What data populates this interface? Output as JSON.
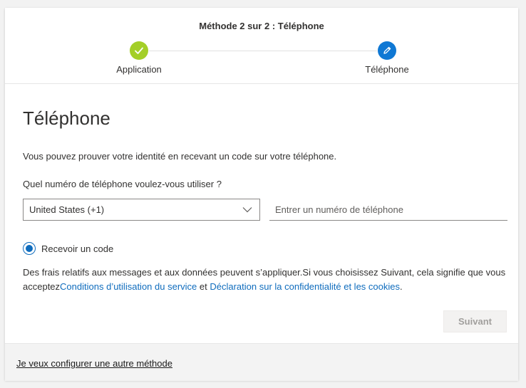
{
  "wizard": {
    "title": "Méthode 2 sur 2 : Téléphone",
    "steps": [
      {
        "label": "Application",
        "status": "completed",
        "icon": "checkmark-icon",
        "color": "#a4cf28"
      },
      {
        "label": "Téléphone",
        "status": "current",
        "icon": "pencil-icon",
        "color": "#0f78d4"
      }
    ]
  },
  "main": {
    "title": "Téléphone",
    "intro": "Vous pouvez prouver votre identité en recevant un code sur votre téléphone.",
    "question": "Quel numéro de téléphone voulez-vous utiliser ?",
    "country_select": {
      "value": "United States (+1)"
    },
    "phone_input": {
      "value": "",
      "placeholder": "Entrer un numéro de téléphone"
    },
    "radio": {
      "label": "Recevoir un code",
      "checked": true
    },
    "disclaimer": {
      "text_before": "Des frais relatifs aux messages et aux données peuvent s’appliquer.Si vous choisissez Suivant, cela signifie que vous acceptez",
      "terms_link": "Conditions d’utilisation du service",
      "connector": " et ",
      "privacy_link": "Déclaration sur la confidentialité et les cookies",
      "text_after": "."
    },
    "next_button": {
      "label": "Suivant",
      "enabled": false
    }
  },
  "footer": {
    "link": "Je veux configurer une autre méthode"
  },
  "colors": {
    "accent": "#0f6cbd",
    "success": "#a4cf28",
    "step_current": "#0f78d4"
  }
}
